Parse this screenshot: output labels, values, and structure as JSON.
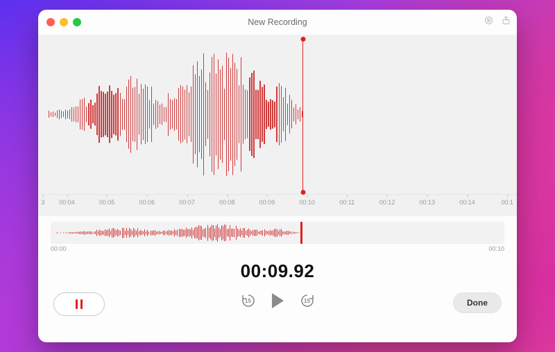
{
  "window": {
    "title": "New Recording"
  },
  "ruler": {
    "ticks": [
      "00:04",
      "00:05",
      "00:06",
      "00:07",
      "00:08",
      "00:09",
      "00:10",
      "00:11",
      "00:12",
      "00:13",
      "00:14",
      "00:1"
    ],
    "left_partial_char": "3"
  },
  "mini": {
    "start_label": "00:00",
    "end_label": "00:10",
    "playhead_percent": 55
  },
  "time": {
    "display": "00:09.92"
  },
  "controls": {
    "skip_seconds_label": "15",
    "done_label": "Done"
  },
  "waveform": {
    "playhead_percent": 55.2,
    "colors": {
      "wave": "#cf3b3b",
      "playhead": "#e02020"
    },
    "num_bars": 230,
    "seed": 92,
    "max_amp": 1.0
  }
}
